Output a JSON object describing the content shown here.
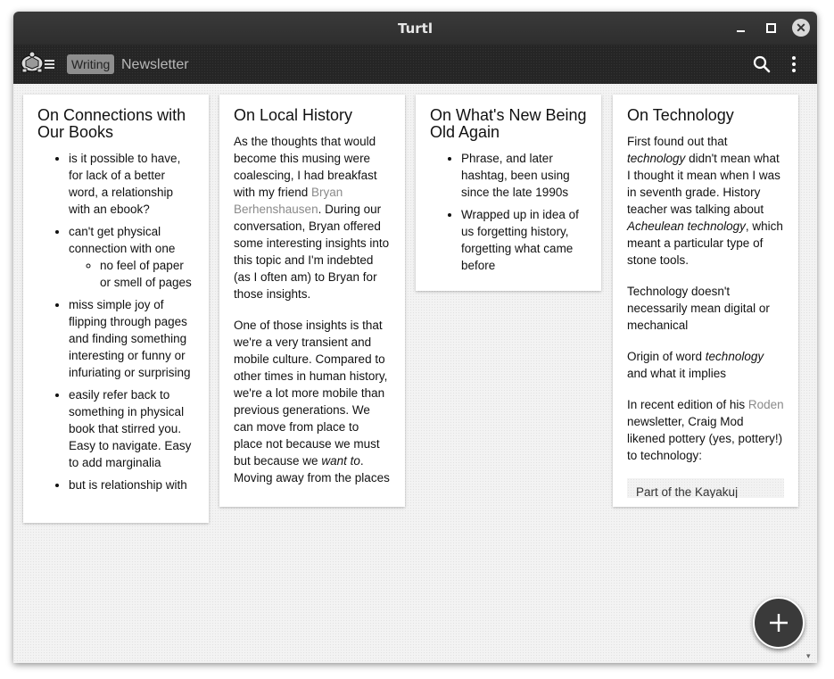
{
  "window": {
    "title": "Turtl"
  },
  "appbar": {
    "tag": "Writing",
    "space_title": "Newsletter",
    "icons": {
      "logo": "turtle-logo-icon",
      "search": "search-icon",
      "more": "kebab-menu-icon"
    }
  },
  "notes": [
    {
      "title": "On Connections with Our Books",
      "items": [
        "is it possible to have, for lack of a better word, a relationship with an ebook?",
        "can't get physical connection with one",
        "no feel of paper or smell of pages",
        "miss simple joy of flipping through pages and finding something interesting or funny or infuriating or surprising",
        "easily refer back to something in physical book that stirred you. Easy to navigate. Easy to add marginalia",
        "but is relationship with"
      ]
    },
    {
      "title": "On Local History",
      "p1_before": "As the thoughts that would become this musing were coalescing, I had breakfast with my friend ",
      "p1_link": "Bryan Berhenshausen",
      "p1_after": ". During our conversation, Bryan offered some interesting insights into this topic and I'm indebted (as I often am) to Bryan for those insights.",
      "p2_before": "One of those insights is that we're a very transient and mobile culture. Compared to other times in human history, we're a lot more mobile than previous generations. We can move from place to place not because we must but because we ",
      "p2_em": "want to",
      "p2_after": ". Moving away from the places"
    },
    {
      "title": "On What's New Being Old Again",
      "items": [
        "Phrase, and later hashtag, been using since the late 1990s",
        "Wrapped up in idea of us forgetting history, forgetting what came before"
      ]
    },
    {
      "title": "On Technology",
      "p1_a": "First found out that ",
      "p1_em1": "technology",
      "p1_b": " didn't mean what I thought it mean when I was in seventh grade. History teacher was talking about ",
      "p1_em2": "Acheulean technology",
      "p1_c": ", which meant a particular type of stone tools.",
      "p2": "Technology doesn't necessarily mean digital or mechanical",
      "p3_a": "Origin of word ",
      "p3_em": "technology",
      "p3_b": " and what it implies",
      "p4_a": "In recent edition of his ",
      "p4_link": "Roden",
      "p4_b": " newsletter, Craig Mod likened pottery (yes, pottery!) to technology:",
      "quote": "Part of the Kayakuj"
    }
  ],
  "fab": {
    "icon": "plus-icon"
  }
}
